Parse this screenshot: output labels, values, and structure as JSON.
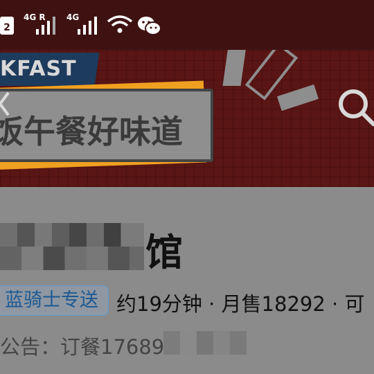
{
  "status_bar": {
    "sim2_badge": "2",
    "net1_label": "4G R",
    "net2_label": "4G",
    "icons": [
      "sim-icon",
      "signal-icon",
      "signal-icon",
      "wifi-icon",
      "wechat-icon"
    ]
  },
  "banner": {
    "ribbon_text": "KFAST",
    "slogan": "饭午餐好味道",
    "colors": {
      "background": "#5a1515",
      "frame": "#f0a020",
      "ribbon": "#1d3b5c"
    }
  },
  "shop": {
    "name_suffix": "馆",
    "delivery_tag": "蓝骑士专送",
    "meta": "约19分钟 · 月售18292 · 可",
    "notice": "公告：订餐17689"
  }
}
